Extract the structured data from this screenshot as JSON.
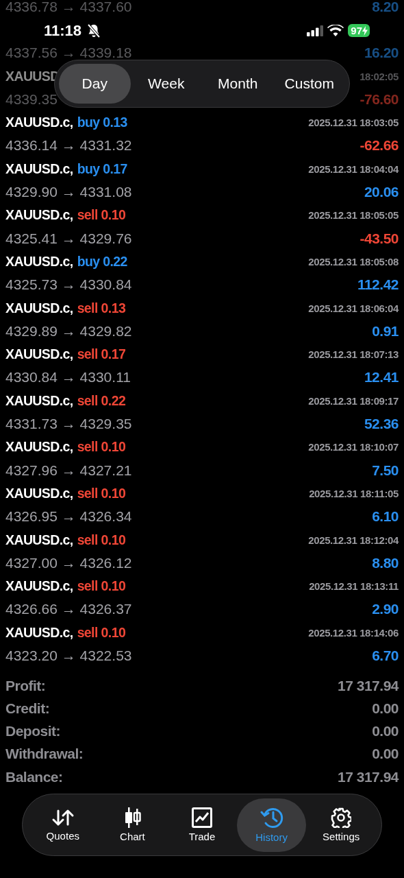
{
  "status_bar": {
    "time": "11:18",
    "battery": "97"
  },
  "period_tabs": [
    {
      "label": "Day",
      "selected": true
    },
    {
      "label": "Week",
      "selected": false
    },
    {
      "label": "Month",
      "selected": false
    },
    {
      "label": "Custom",
      "selected": false
    }
  ],
  "trades": [
    {
      "dimmed": true,
      "prices": "4336.78 → 4337.60",
      "profit": "8.20",
      "loss": false
    },
    {
      "dimmed": true,
      "prices": "4337.56 → 4339.18",
      "profit": "16.20",
      "loss": false
    },
    {
      "dimmed": true,
      "symbol": "XAUUSD",
      "time": "18:02:05",
      "prices": "4339.35",
      "profit": "-76.60",
      "loss": true
    },
    {
      "dimmed": false,
      "symbol": "XAUUSD.c,",
      "side": "buy 0.13",
      "kind": "buy",
      "time": "2025.12.31 18:03:05",
      "prices": "4336.14 → 4331.32",
      "profit": "-62.66",
      "loss": true
    },
    {
      "dimmed": false,
      "symbol": "XAUUSD.c,",
      "side": "buy 0.17",
      "kind": "buy",
      "time": "2025.12.31 18:04:04",
      "prices": "4329.90 → 4331.08",
      "profit": "20.06",
      "loss": false
    },
    {
      "dimmed": false,
      "symbol": "XAUUSD.c,",
      "side": "sell 0.10",
      "kind": "sell",
      "time": "2025.12.31 18:05:05",
      "prices": "4325.41 → 4329.76",
      "profit": "-43.50",
      "loss": true
    },
    {
      "dimmed": false,
      "symbol": "XAUUSD.c,",
      "side": "buy 0.22",
      "kind": "buy",
      "time": "2025.12.31 18:05:08",
      "prices": "4325.73 → 4330.84",
      "profit": "112.42",
      "loss": false
    },
    {
      "dimmed": false,
      "symbol": "XAUUSD.c,",
      "side": "sell 0.13",
      "kind": "sell",
      "time": "2025.12.31 18:06:04",
      "prices": "4329.89 → 4329.82",
      "profit": "0.91",
      "loss": false
    },
    {
      "dimmed": false,
      "symbol": "XAUUSD.c,",
      "side": "sell 0.17",
      "kind": "sell",
      "time": "2025.12.31 18:07:13",
      "prices": "4330.84 → 4330.11",
      "profit": "12.41",
      "loss": false
    },
    {
      "dimmed": false,
      "symbol": "XAUUSD.c,",
      "side": "sell 0.22",
      "kind": "sell",
      "time": "2025.12.31 18:09:17",
      "prices": "4331.73 → 4329.35",
      "profit": "52.36",
      "loss": false
    },
    {
      "dimmed": false,
      "symbol": "XAUUSD.c,",
      "side": "sell 0.10",
      "kind": "sell",
      "time": "2025.12.31 18:10:07",
      "prices": "4327.96 → 4327.21",
      "profit": "7.50",
      "loss": false
    },
    {
      "dimmed": false,
      "symbol": "XAUUSD.c,",
      "side": "sell 0.10",
      "kind": "sell",
      "time": "2025.12.31 18:11:05",
      "prices": "4326.95 → 4326.34",
      "profit": "6.10",
      "loss": false
    },
    {
      "dimmed": false,
      "symbol": "XAUUSD.c,",
      "side": "sell 0.10",
      "kind": "sell",
      "time": "2025.12.31 18:12:04",
      "prices": "4327.00 → 4326.12",
      "profit": "8.80",
      "loss": false
    },
    {
      "dimmed": false,
      "symbol": "XAUUSD.c,",
      "side": "sell 0.10",
      "kind": "sell",
      "time": "2025.12.31 18:13:11",
      "prices": "4326.66 → 4326.37",
      "profit": "2.90",
      "loss": false
    },
    {
      "dimmed": false,
      "symbol": "XAUUSD.c,",
      "side": "sell 0.10",
      "kind": "sell",
      "time": "2025.12.31 18:14:06",
      "prices": "4323.20 → 4322.53",
      "profit": "6.70",
      "loss": false
    }
  ],
  "summary": [
    {
      "label": "Profit:",
      "value": "17 317.94"
    },
    {
      "label": "Credit:",
      "value": "0.00"
    },
    {
      "label": "Deposit:",
      "value": "0.00"
    },
    {
      "label": "Withdrawal:",
      "value": "0.00"
    },
    {
      "label": "Balance:",
      "value": "17 317.94"
    }
  ],
  "tab_bar": [
    {
      "label": "Quotes",
      "kind": "quotes",
      "selected": false
    },
    {
      "label": "Chart",
      "kind": "chart",
      "selected": false
    },
    {
      "label": "Trade",
      "kind": "trade",
      "selected": false
    },
    {
      "label": "History",
      "kind": "history",
      "selected": true
    },
    {
      "label": "Settings",
      "kind": "settings",
      "selected": false
    }
  ]
}
